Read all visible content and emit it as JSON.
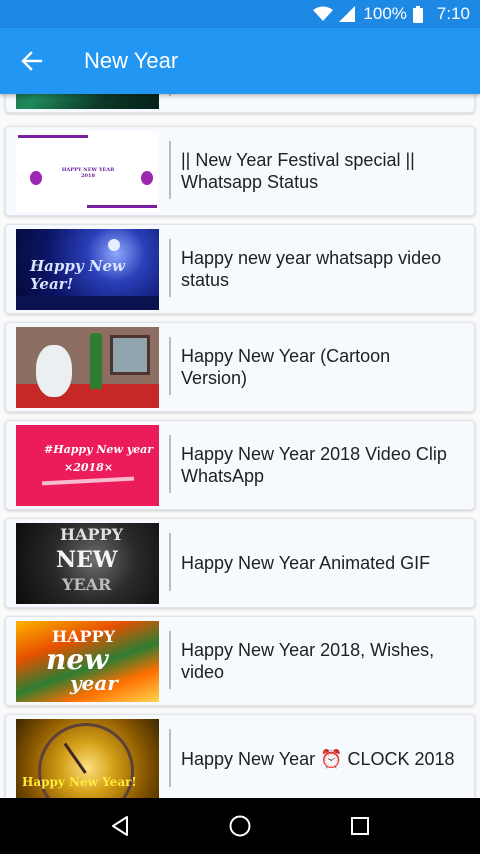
{
  "status_bar": {
    "battery": "100%",
    "time": "7:10"
  },
  "app_bar": {
    "title": "New Year"
  },
  "items": [
    {
      "title": ""
    },
    {
      "title": "|| New Year Festival special || Whatsapp Status",
      "thumb_text": "HAPPY NEW YEAR 2018"
    },
    {
      "title": "Happy new year whatsapp video status",
      "thumb_text": "Happy New Year!"
    },
    {
      "title": "Happy New Year (Cartoon Version)"
    },
    {
      "title": "Happy New Year 2018 Video Clip  WhatsApp",
      "thumb_text": "#Happy New year",
      "thumb_text2": "×2018×"
    },
    {
      "title": "Happy New Year Animated GIF",
      "thumb_text": "HAPPY",
      "thumb_text2": "NEW",
      "thumb_text3": "YEAR"
    },
    {
      "title": "Happy New Year 2018, Wishes, video",
      "thumb_text": "HAPPY",
      "thumb_text2": "new",
      "thumb_text3": "year"
    },
    {
      "title": "Happy New Year ⏰ CLOCK 2018",
      "thumb_text": "Happy New Year!"
    }
  ],
  "colors": {
    "status_bar": "#1e88e5",
    "app_bar": "#2196f3"
  }
}
